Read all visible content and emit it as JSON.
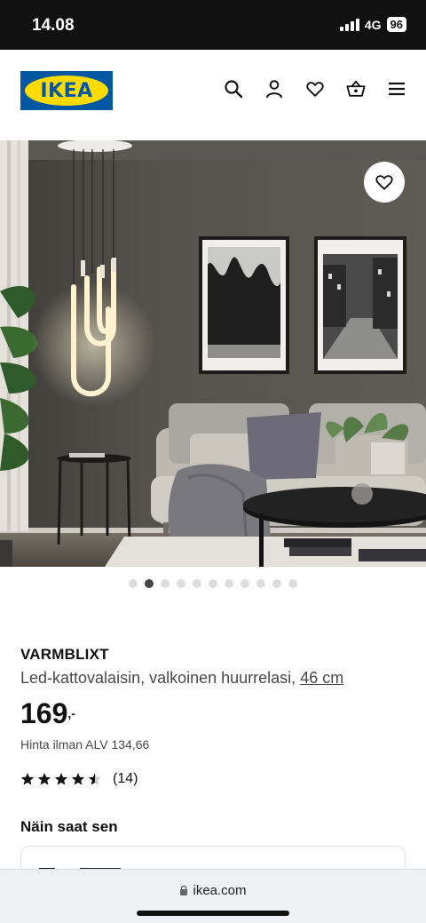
{
  "status_bar": {
    "time": "14.08",
    "network": "4G",
    "battery": "96"
  },
  "header": {
    "logo_text": "IKEA"
  },
  "product": {
    "name": "VARMBLIXT",
    "description": "Led-kattovalaisin, valkoinen huurrelasi,",
    "size": "46 cm",
    "price": "169",
    "price_suffix": ",-",
    "vat_text": "Hinta ilman ALV 134,66",
    "rating_stars": 4.5,
    "rating_count": "(14)"
  },
  "carousel": {
    "total": 11,
    "active_index": 1
  },
  "delivery": {
    "title": "Näin saat sen"
  },
  "browser": {
    "url": "ikea.com"
  },
  "colors": {
    "ikea_blue": "#0058a3",
    "ikea_yellow": "#ffdb00"
  }
}
